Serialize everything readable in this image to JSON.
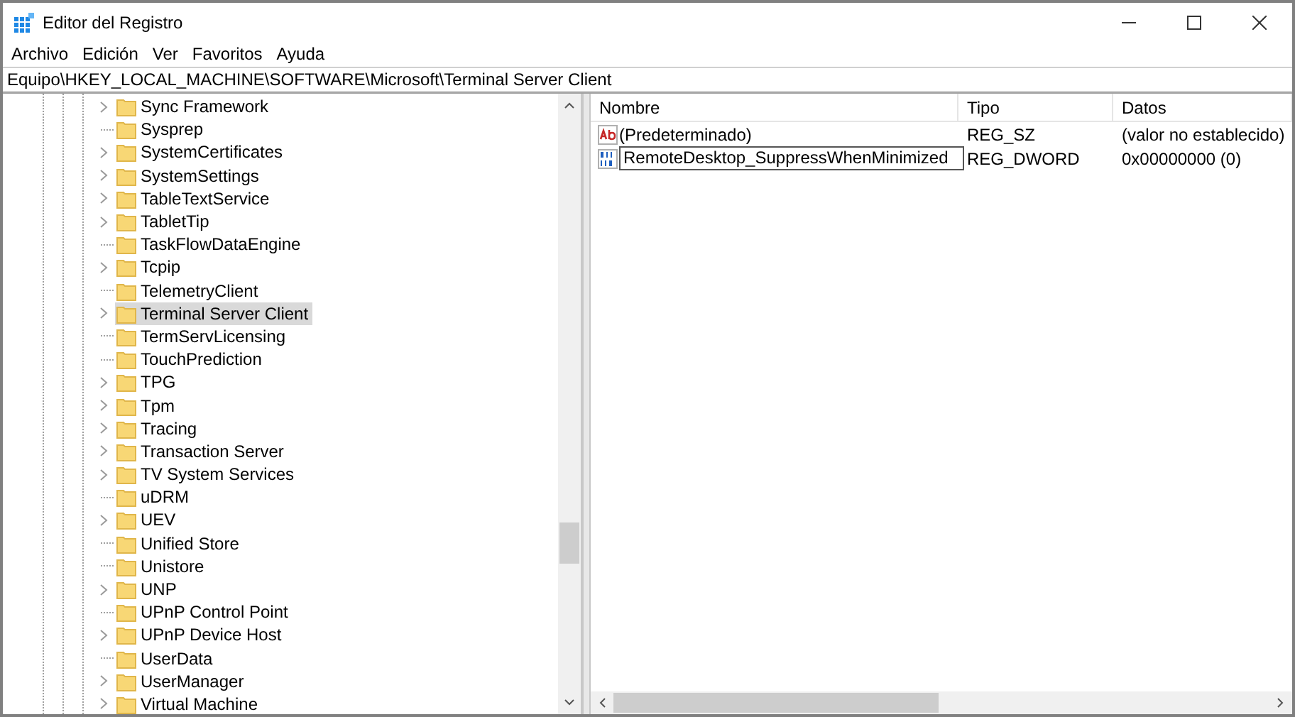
{
  "window": {
    "title": "Editor del Registro"
  },
  "menu": [
    "Archivo",
    "Edición",
    "Ver",
    "Favoritos",
    "Ayuda"
  ],
  "address": "Equipo\\HKEY_LOCAL_MACHINE\\SOFTWARE\\Microsoft\\Terminal Server Client",
  "tree": {
    "items": [
      {
        "label": "Sync Framework",
        "expandable": true,
        "selected": false
      },
      {
        "label": "Sysprep",
        "expandable": false,
        "selected": false
      },
      {
        "label": "SystemCertificates",
        "expandable": true,
        "selected": false
      },
      {
        "label": "SystemSettings",
        "expandable": true,
        "selected": false
      },
      {
        "label": "TableTextService",
        "expandable": true,
        "selected": false
      },
      {
        "label": "TabletTip",
        "expandable": true,
        "selected": false
      },
      {
        "label": "TaskFlowDataEngine",
        "expandable": false,
        "selected": false
      },
      {
        "label": "Tcpip",
        "expandable": true,
        "selected": false
      },
      {
        "label": "TelemetryClient",
        "expandable": false,
        "selected": false
      },
      {
        "label": "Terminal Server Client",
        "expandable": true,
        "selected": true
      },
      {
        "label": "TermServLicensing",
        "expandable": false,
        "selected": false
      },
      {
        "label": "TouchPrediction",
        "expandable": false,
        "selected": false
      },
      {
        "label": "TPG",
        "expandable": true,
        "selected": false
      },
      {
        "label": "Tpm",
        "expandable": true,
        "selected": false
      },
      {
        "label": "Tracing",
        "expandable": true,
        "selected": false
      },
      {
        "label": "Transaction Server",
        "expandable": true,
        "selected": false
      },
      {
        "label": "TV System Services",
        "expandable": true,
        "selected": false
      },
      {
        "label": "uDRM",
        "expandable": false,
        "selected": false
      },
      {
        "label": "UEV",
        "expandable": true,
        "selected": false
      },
      {
        "label": "Unified Store",
        "expandable": false,
        "selected": false
      },
      {
        "label": "Unistore",
        "expandable": false,
        "selected": false
      },
      {
        "label": "UNP",
        "expandable": true,
        "selected": false
      },
      {
        "label": "UPnP Control Point",
        "expandable": false,
        "selected": false
      },
      {
        "label": "UPnP Device Host",
        "expandable": true,
        "selected": false
      },
      {
        "label": "UserData",
        "expandable": false,
        "selected": false
      },
      {
        "label": "UserManager",
        "expandable": true,
        "selected": false
      },
      {
        "label": "Virtual Machine",
        "expandable": true,
        "selected": false
      }
    ]
  },
  "values": {
    "columns": [
      "Nombre",
      "Tipo",
      "Datos"
    ],
    "rows": [
      {
        "kind": "string",
        "name": "(Predeterminado)",
        "type": "REG_SZ",
        "data": "(valor no establecido)",
        "editing": false
      },
      {
        "kind": "dword",
        "name": "RemoteDesktop_SuppressWhenMinimized",
        "type": "REG_DWORD",
        "data": "0x00000000 (0)",
        "editing": true
      }
    ]
  }
}
